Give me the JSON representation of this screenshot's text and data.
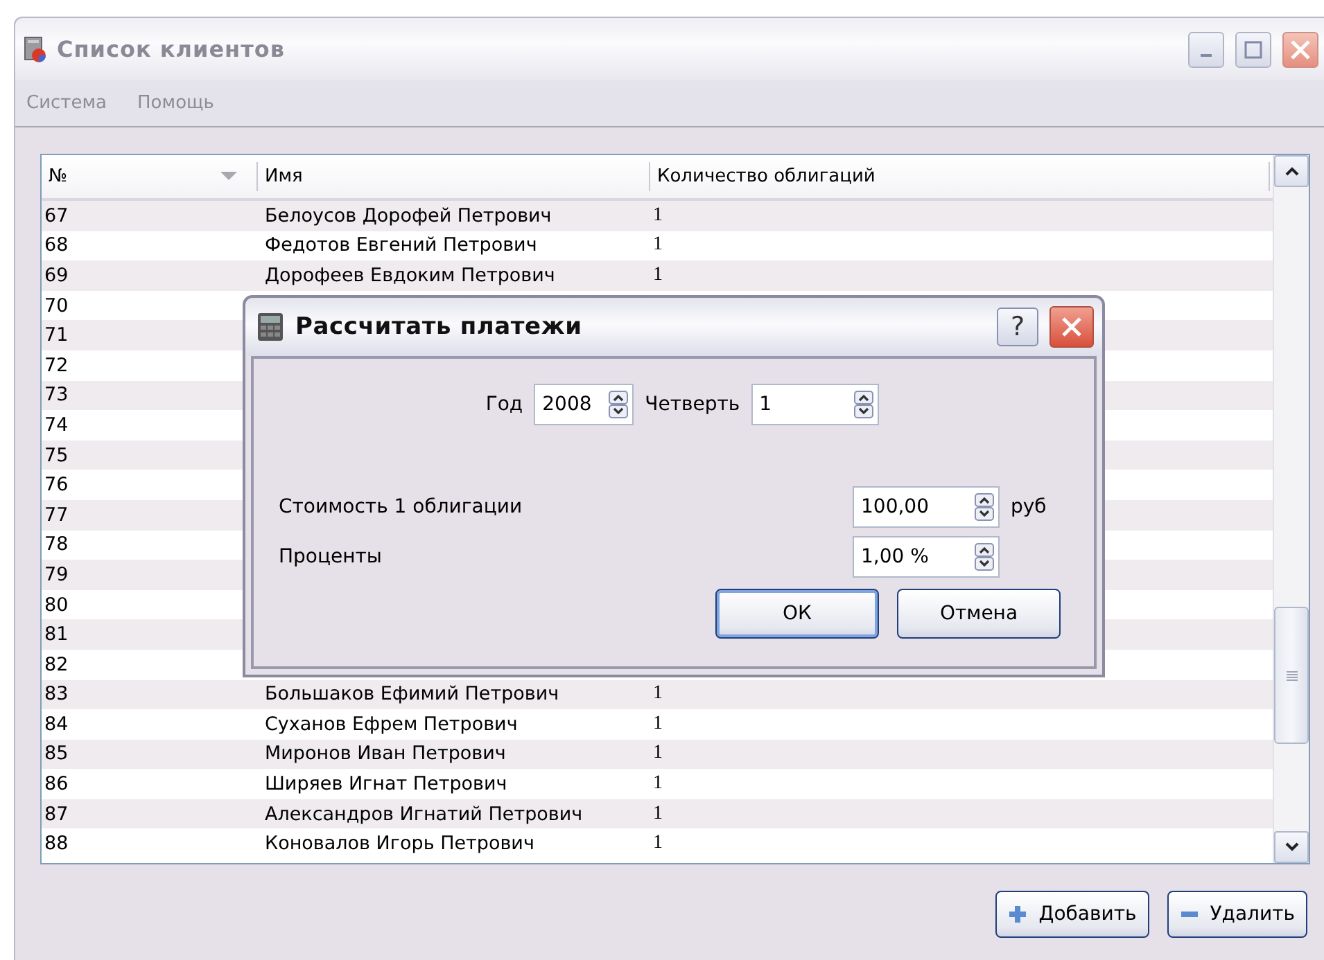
{
  "window": {
    "title": "Список клиентов"
  },
  "menu": [
    "Система",
    "Помощь"
  ],
  "table": {
    "columns": [
      {
        "label": "№",
        "sorted": true
      },
      {
        "label": "Имя",
        "sorted": false
      },
      {
        "label": "Количество облигаций",
        "sorted": false
      }
    ],
    "rows": [
      {
        "number": "67",
        "name": "Белоусов Дорофей Петрович",
        "bonds": "1"
      },
      {
        "number": "68",
        "name": "Федотов Евгений Петрович",
        "bonds": "1"
      },
      {
        "number": "69",
        "name": "Дорофеев Евдоким Петрович",
        "bonds": "1"
      },
      {
        "number": "70"
      },
      {
        "number": "71"
      },
      {
        "number": "72"
      },
      {
        "number": "73"
      },
      {
        "number": "74"
      },
      {
        "number": "75"
      },
      {
        "number": "76"
      },
      {
        "number": "77"
      },
      {
        "number": "78"
      },
      {
        "number": "79"
      },
      {
        "number": "80"
      },
      {
        "number": "81"
      },
      {
        "number": "82"
      },
      {
        "number": "83",
        "name": "Большаков Ефимий Петрович",
        "bonds": "1"
      },
      {
        "number": "84",
        "name": "Суханов Ефрем Петрович",
        "bonds": "1"
      },
      {
        "number": "85",
        "name": "Миронов Иван Петрович",
        "bonds": "1"
      },
      {
        "number": "86",
        "name": "Ширяев Игнат Петрович",
        "bonds": "1"
      },
      {
        "number": "87",
        "name": "Александров Игнатий Петрович",
        "bonds": "1"
      },
      {
        "number": "88",
        "name": "Коновалов Игорь Петрович",
        "bonds": "1"
      }
    ]
  },
  "buttons": [
    {
      "kind": "add",
      "label": "Добавить"
    },
    {
      "kind": "remove",
      "label": "Удалить"
    }
  ],
  "dialog": {
    "title": "Рассчитать платежи",
    "help": "?",
    "year_label": "Год",
    "year": "2008",
    "quarter_label": "Четверть",
    "quarter": "1",
    "fields": [
      {
        "label": "Стоимость 1 облигации",
        "value": "100,00",
        "unit": "руб"
      },
      {
        "label": "Проценты",
        "value": "1,00 %"
      }
    ],
    "buttons": [
      {
        "kind": "default",
        "label": "ОК"
      },
      {
        "kind": "normal",
        "label": "Отмена"
      }
    ]
  }
}
